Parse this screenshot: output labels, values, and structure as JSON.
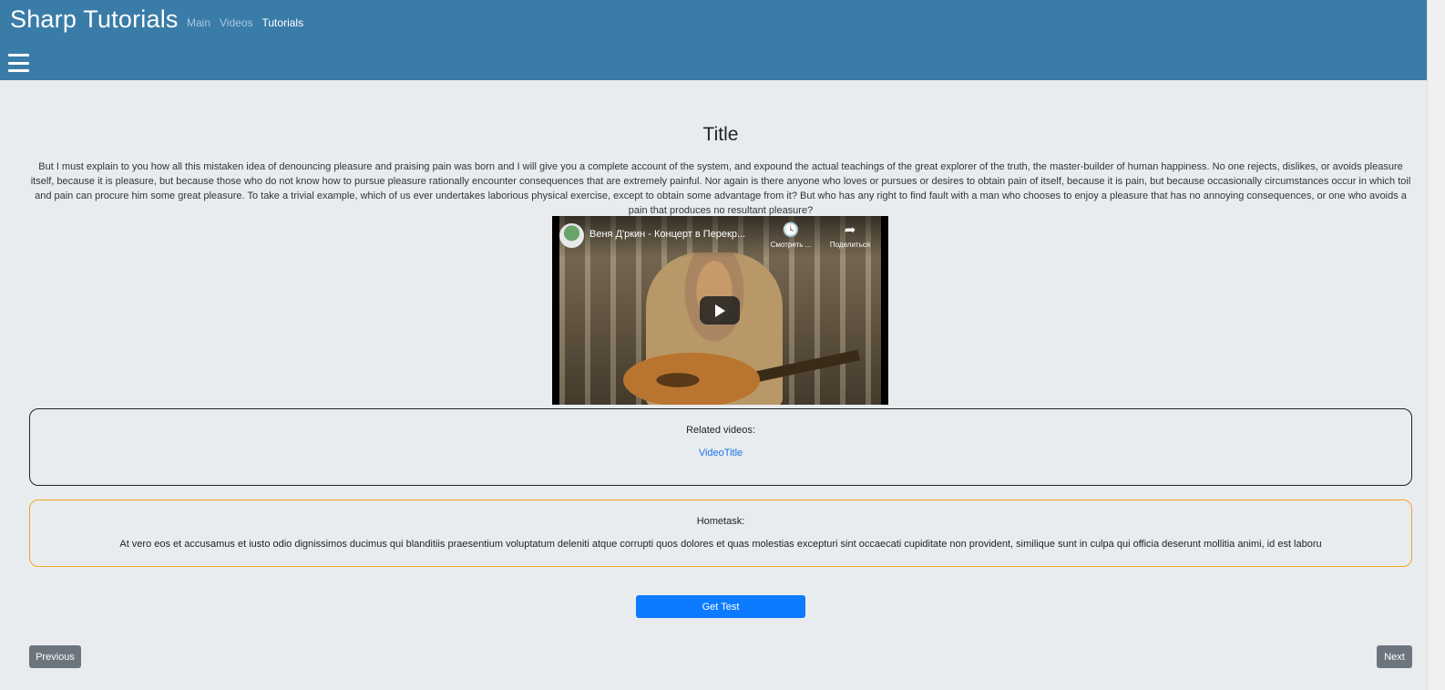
{
  "header": {
    "brand": "Sharp Tutorials",
    "nav": [
      {
        "label": "Main",
        "active": false
      },
      {
        "label": "Videos",
        "active": false
      },
      {
        "label": "Tutorials",
        "active": true
      }
    ],
    "menu_icon": "hamburger-icon",
    "background_color": "#3a7ca8"
  },
  "article": {
    "title": "Title",
    "intro": "But I must explain to you how all this mistaken idea of denouncing pleasure and praising pain was born and I will give you a complete account of the system, and expound the actual teachings of the great explorer of the truth, the master-builder of human happiness. No one rejects, dislikes, or avoids pleasure itself, because it is pleasure, but because those who do not know how to pursue pleasure rationally encounter consequences that are extremely painful. Nor again is there anyone who loves or pursues or desires to obtain pain of itself, because it is pain, but because occasionally circumstances occur in which toil and pain can procure him some great pleasure. To take a trivial example, which of us ever undertakes laborious physical exercise, except to obtain some advantage from it? But who has any right to find fault with a man who chooses to enjoy a pleasure that has no annoying consequences, or one who avoids a pain that produces no resultant pleasure?"
  },
  "video": {
    "title": "Веня Д'ркин - Концерт в Перекр...",
    "watch_later_label": "Смотреть ...",
    "share_label": "Поделиться",
    "watch_later_icon": "clock-icon",
    "share_icon": "share-arrow-icon",
    "play_icon": "play-icon"
  },
  "related": {
    "heading": "Related videos:",
    "link": "VideoTitle",
    "border_color": "#222222"
  },
  "hometask": {
    "heading": "Hometask:",
    "text": "At vero eos et accusamus et iusto odio dignissimos ducimus qui blanditiis praesentium voluptatum deleniti atque corrupti quos dolores et quas molestias excepturi sint occaecati cupiditate non provident, similique sunt in culpa qui officia deserunt mollitia animi, id est laboru",
    "border_color": "#f2a61f"
  },
  "actions": {
    "get_test": "Get Test",
    "previous": "Previous",
    "next": "Next",
    "primary_color": "#0d7bff",
    "secondary_color": "#6c757d"
  }
}
